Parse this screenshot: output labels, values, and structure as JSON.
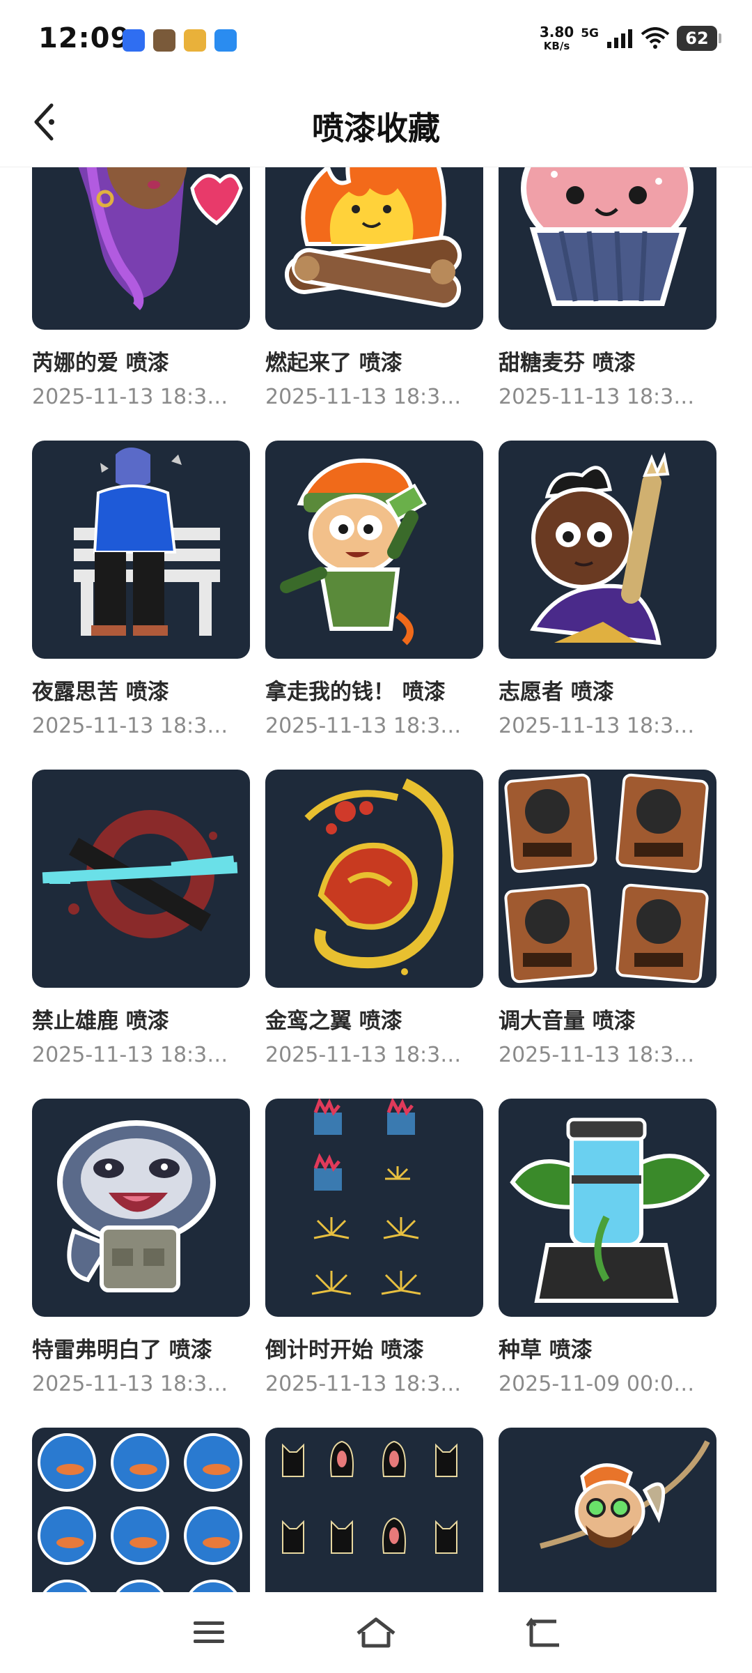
{
  "status_bar": {
    "time": "12:09",
    "net_speed_value": "3.80",
    "net_speed_unit": "KB/s",
    "network": "5G",
    "battery": "62"
  },
  "header": {
    "title": "喷漆收藏"
  },
  "items": [
    {
      "title": "芮娜的爱 喷漆",
      "date": "2025-11-13 18:3…"
    },
    {
      "title": "燃起来了 喷漆",
      "date": "2025-11-13 18:3…"
    },
    {
      "title": "甜糖麦芬 喷漆",
      "date": "2025-11-13 18:3…"
    },
    {
      "title": "夜露思苦 喷漆",
      "date": "2025-11-13 18:3…"
    },
    {
      "title": "拿走我的钱！ 喷漆",
      "date": "2025-11-13 18:3…"
    },
    {
      "title": "志愿者 喷漆",
      "date": "2025-11-13 18:3…"
    },
    {
      "title": "禁止雄鹿 喷漆",
      "date": "2025-11-13 18:3…"
    },
    {
      "title": "金鸾之翼 喷漆",
      "date": "2025-11-13 18:3…"
    },
    {
      "title": "调大音量 喷漆",
      "date": "2025-11-13 18:3…"
    },
    {
      "title": "特雷弗明白了 喷漆",
      "date": "2025-11-13 18:3…"
    },
    {
      "title": "倒计时开始 喷漆",
      "date": "2025-11-13 18:3…"
    },
    {
      "title": "种草 喷漆",
      "date": "2025-11-09 00:0…"
    },
    {
      "title": "",
      "date": ""
    },
    {
      "title": "",
      "date": ""
    },
    {
      "title": "",
      "date": ""
    }
  ],
  "colors": {
    "thumb_bg": "#1e2a3a",
    "title_text": "#2a2a2a",
    "date_text": "#8a8a8a"
  },
  "icons": {
    "back": "back-chevron-icon",
    "menu": "menu-icon",
    "home": "home-icon",
    "return": "return-icon"
  }
}
